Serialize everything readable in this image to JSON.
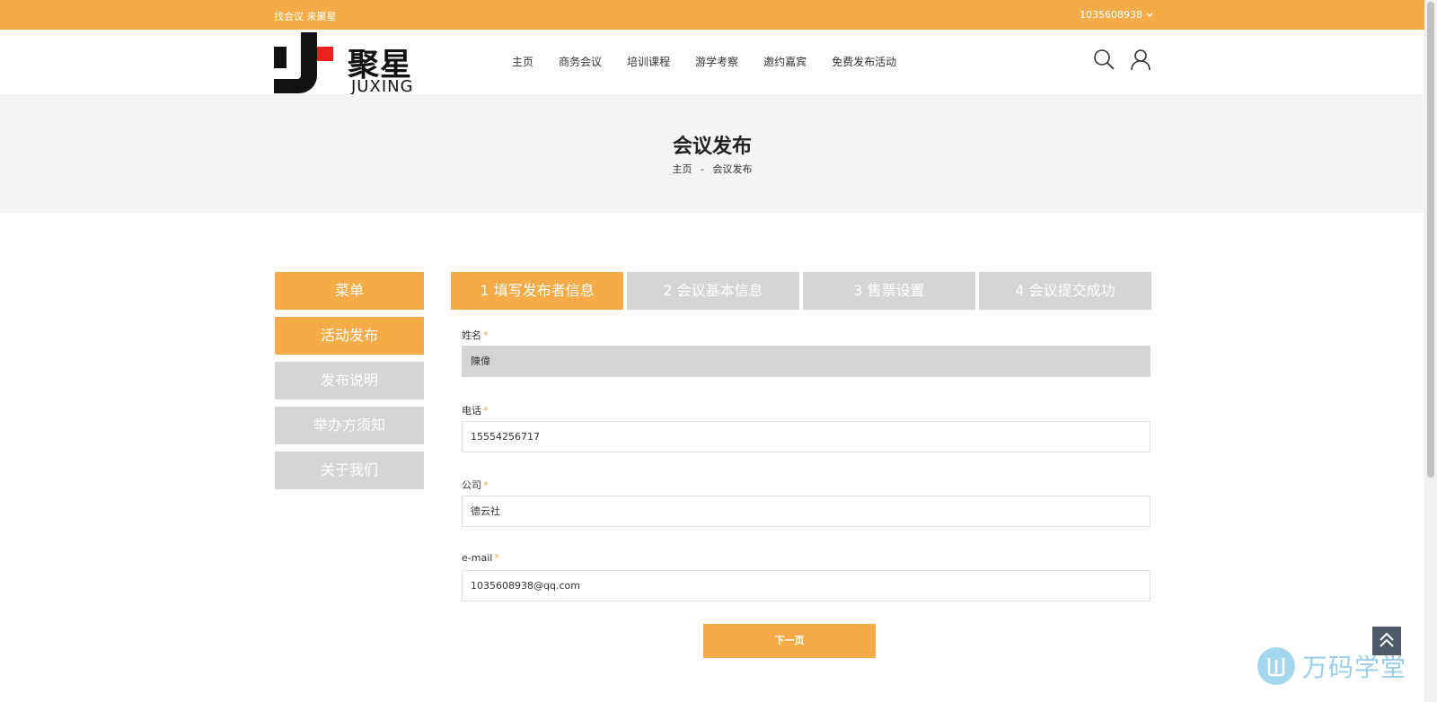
{
  "topbar": {
    "slogan": "找会议 来聚星",
    "account": "1035608938"
  },
  "logo": {
    "cn": "聚星",
    "en": "JUXING"
  },
  "nav": [
    "主页",
    "商务会议",
    "培训课程",
    "游学考察",
    "邀约嘉宾",
    "免费发布活动"
  ],
  "banner": {
    "title": "会议发布",
    "crumb_home": "主页",
    "crumb_sep": "-",
    "crumb_current": "会议发布"
  },
  "sidebar": {
    "title": "菜单",
    "items": [
      {
        "label": "活动发布",
        "active": true
      },
      {
        "label": "发布说明",
        "active": false
      },
      {
        "label": "举办方须知",
        "active": false
      },
      {
        "label": "关于我们",
        "active": false
      }
    ]
  },
  "steps": [
    {
      "label": "1 填写发布者信息",
      "active": true
    },
    {
      "label": "2 会议基本信息",
      "active": false
    },
    {
      "label": "3 售票设置",
      "active": false
    },
    {
      "label": "4 会议提交成功",
      "active": false
    }
  ],
  "form": {
    "name_label": "姓名",
    "name_value": "陳偉",
    "phone_label": "电话",
    "phone_value": "15554256717",
    "company_label": "公司",
    "company_value": "德云社",
    "email_label": "e-mail",
    "email_value": "1035608938@qq.com",
    "required_mark": "*"
  },
  "next_button": "下一页",
  "watermark": "万码学堂",
  "colors": {
    "accent": "#f5ab47",
    "inactive": "#d5d5d5",
    "logo_red": "#e52420"
  }
}
